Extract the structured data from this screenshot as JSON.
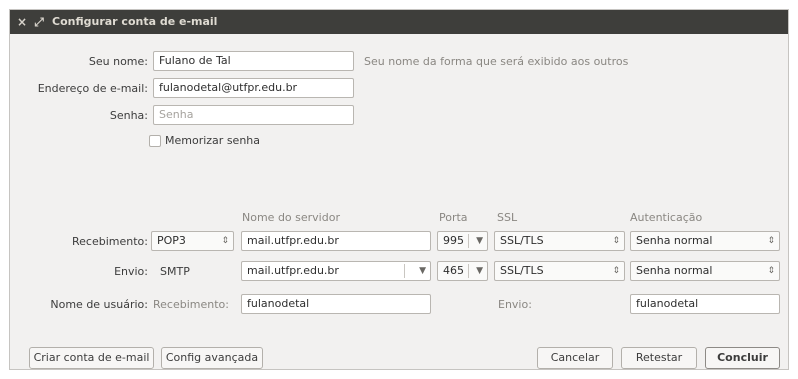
{
  "window": {
    "title": "Configurar conta de e-mail",
    "close_glyph": "×",
    "resize_glyph": "⤢"
  },
  "identity": {
    "name_label": "Seu nome:",
    "name_value": "Fulano de Tal",
    "name_hint": "Seu nome da forma que será exibido aos outros",
    "email_label": "Endereço de e-mail:",
    "email_value": "fulanodetal@utfpr.edu.br",
    "password_label": "Senha:",
    "password_placeholder": "Senha",
    "remember_label": "Memorizar senha",
    "remember_checked": false
  },
  "servers": {
    "headers": {
      "server": "Nome do servidor",
      "port": "Porta",
      "ssl": "SSL",
      "auth": "Autenticação"
    },
    "incoming": {
      "label": "Recebimento:",
      "protocol": "POP3",
      "server": "mail.utfpr.edu.br",
      "port": "995",
      "ssl": "SSL/TLS",
      "auth": "Senha normal"
    },
    "outgoing": {
      "label": "Envio:",
      "protocol": "SMTP",
      "server": "mail.utfpr.edu.br",
      "port": "465",
      "ssl": "SSL/TLS",
      "auth": "Senha normal"
    },
    "username": {
      "label": "Nome de usuário:",
      "incoming_label": "Recebimento:",
      "incoming_value": "fulanodetal",
      "outgoing_label": "Envio:",
      "outgoing_value": "fulanodetal"
    }
  },
  "buttons": {
    "create_account": "Criar conta de e-mail",
    "advanced": "Config avançada",
    "cancel": "Cancelar",
    "retest": "Retestar",
    "done": "Concluir"
  },
  "icons": {
    "close": "close-icon",
    "resize": "resize-icon",
    "spinner": "up-down-arrows-icon",
    "dropdown": "dropdown-arrow-icon"
  },
  "spinner_glyph": "⇕",
  "dropdown_glyph": "▼"
}
